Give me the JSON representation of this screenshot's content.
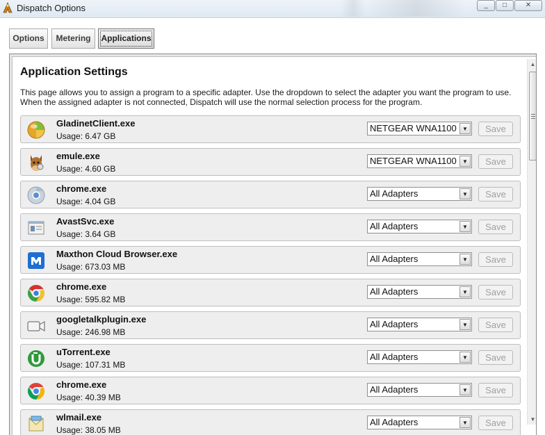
{
  "window": {
    "title": "Dispatch Options",
    "controls": {
      "minimize": "_",
      "maximize": "□",
      "close": "✕"
    }
  },
  "tabs": [
    {
      "label": "Options",
      "selected": false
    },
    {
      "label": "Metering",
      "selected": false
    },
    {
      "label": "Applications",
      "selected": true
    }
  ],
  "page": {
    "heading": "Application Settings",
    "description": "This page allows you to assign a program to a specific adapter. Use the dropdown to select the adapter you want the program to use. When the assigned adapter is not connected, Dispatch will use the normal selection process for the program."
  },
  "save_label": "Save",
  "scrollbar": {
    "up": "▲",
    "down": "▼",
    "position": 0.0
  },
  "apps": [
    {
      "name": "GladinetClient.exe",
      "usage": "Usage: 6.47 GB",
      "adapter": "NETGEAR WNA1100",
      "icon": "gladinet-icon"
    },
    {
      "name": "emule.exe",
      "usage": "Usage: 4.60 GB",
      "adapter": "NETGEAR WNA1100",
      "icon": "emule-icon"
    },
    {
      "name": "chrome.exe",
      "usage": "Usage: 4.04 GB",
      "adapter": "All Adapters",
      "icon": "chrome-bw-icon"
    },
    {
      "name": "AvastSvc.exe",
      "usage": "Usage: 3.64 GB",
      "adapter": "All Adapters",
      "icon": "avast-icon"
    },
    {
      "name": "Maxthon Cloud Browser.exe",
      "usage": "Usage: 673.03 MB",
      "adapter": "All Adapters",
      "icon": "maxthon-icon"
    },
    {
      "name": "chrome.exe",
      "usage": "Usage: 595.82 MB",
      "adapter": "All Adapters",
      "icon": "chrome-old-icon"
    },
    {
      "name": "googletalkplugin.exe",
      "usage": "Usage: 246.98 MB",
      "adapter": "All Adapters",
      "icon": "videocam-icon"
    },
    {
      "name": "uTorrent.exe",
      "usage": "Usage: 107.31 MB",
      "adapter": "All Adapters",
      "icon": "utorrent-icon"
    },
    {
      "name": "chrome.exe",
      "usage": "Usage: 40.39 MB",
      "adapter": "All Adapters",
      "icon": "chrome-icon"
    },
    {
      "name": "wlmail.exe",
      "usage": "Usage: 38.05 MB",
      "adapter": "All Adapters",
      "icon": "wlmail-icon"
    }
  ]
}
